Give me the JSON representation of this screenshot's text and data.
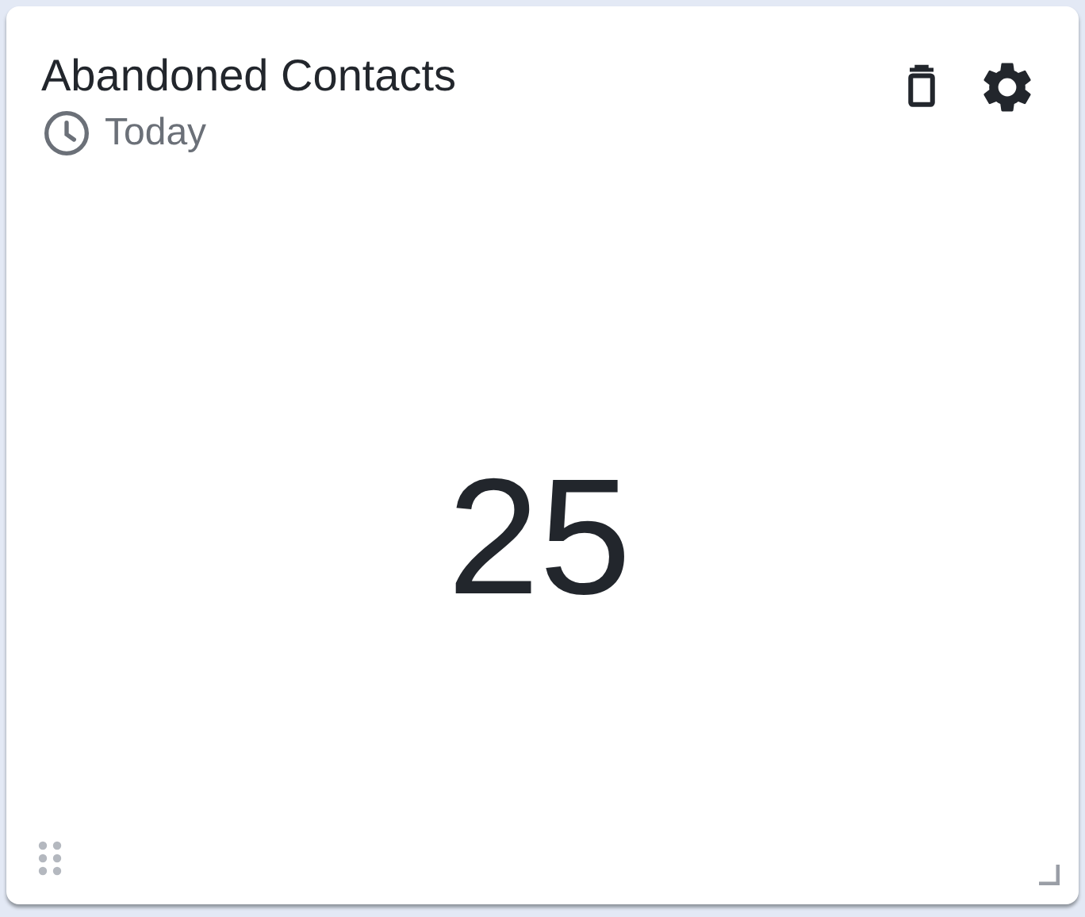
{
  "widget": {
    "title": "Abandoned Contacts",
    "period": "Today",
    "value": "25"
  }
}
